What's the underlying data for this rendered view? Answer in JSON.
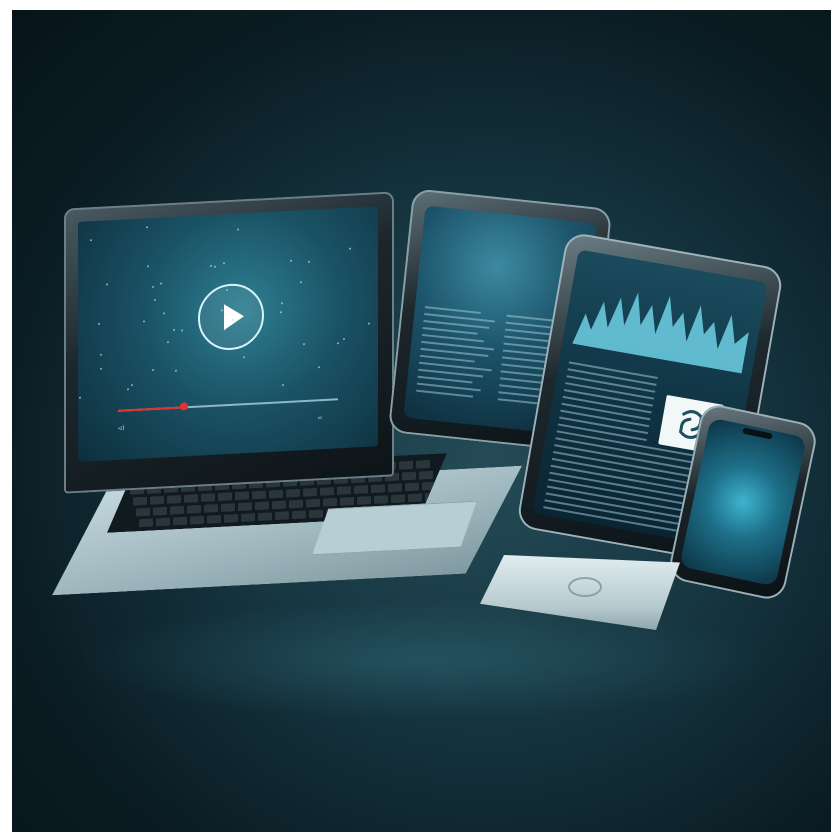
{
  "scene": {
    "description_tags": [
      "laptop",
      "tablet",
      "tablet",
      "smartphone",
      "pad"
    ],
    "colors": {
      "accent": "#3fb3cf",
      "progress": "#e3322c",
      "background": "#0b1d24"
    }
  },
  "laptop": {
    "screen": {
      "playback_progress_percent": 30
    },
    "icons": [
      "play-icon",
      "volume-icon",
      "fullscreen-icon"
    ]
  },
  "tablet_right": {
    "icon_tile": "cycle-icon"
  }
}
